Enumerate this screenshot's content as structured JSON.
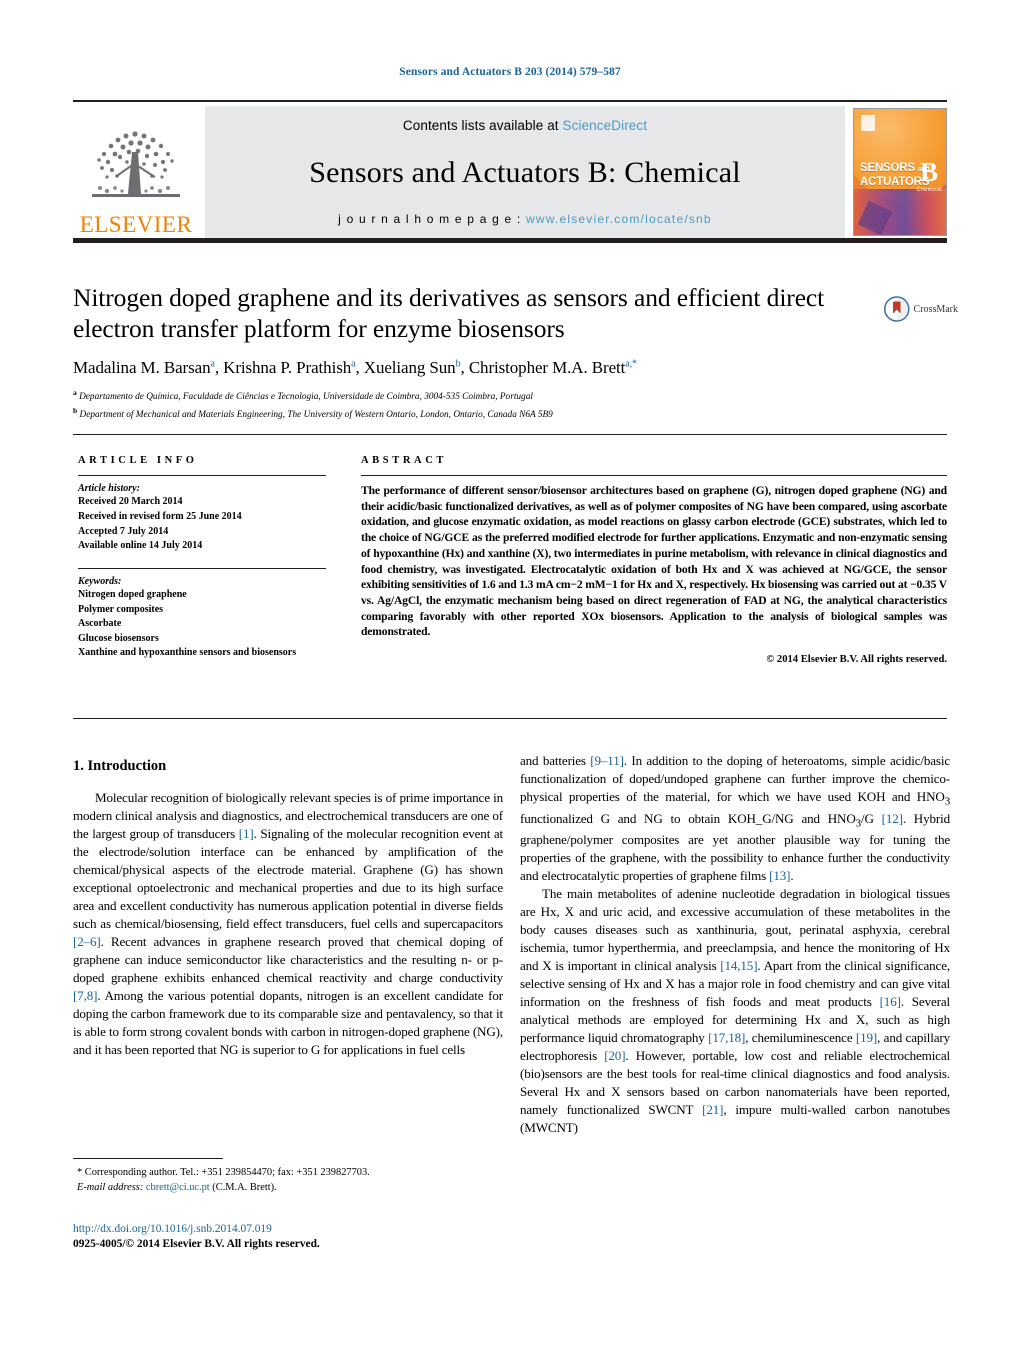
{
  "running_head": "Sensors and Actuators B 203 (2014) 579–587",
  "masthead": {
    "contents_prefix": "Contents lists available at ",
    "sciencedirect": "ScienceDirect",
    "journal_title": "Sensors and Actuators B: Chemical",
    "homepage_prefix": "j o u r n a l   h o m e p a g e :  ",
    "homepage_url": "www.elsevier.com/locate/snb",
    "publisher_wordmark": "ELSEVIER",
    "cover": {
      "line1": "SENSORS",
      "and": "and",
      "line2": "ACTUATORS",
      "letter": "B",
      "sub": "Chemical"
    }
  },
  "crossmark": {
    "label": "CrossMark"
  },
  "article": {
    "title": "Nitrogen doped graphene and its derivatives as sensors and efficient direct electron transfer platform for enzyme biosensors",
    "authors": [
      {
        "name": "Madalina M. Barsan",
        "sup": "a"
      },
      {
        "name": "Krishna P. Prathish",
        "sup": "a"
      },
      {
        "name": "Xueliang Sun",
        "sup": "b"
      },
      {
        "name": "Christopher M.A. Brett",
        "sup": "a,*"
      }
    ],
    "affiliations": [
      {
        "marker": "a",
        "text": "Departamento de Química, Faculdade de Ciências e Tecnologia, Universidade de Coimbra, 3004-535 Coimbra, Portugal"
      },
      {
        "marker": "b",
        "text": "Department of Mechanical and Materials Engineering, The University of Western Ontario, London, Ontario, Canada N6A 5B9"
      }
    ]
  },
  "article_info": {
    "heading": "ARTICLE INFO",
    "history_label": "Article history:",
    "history": [
      "Received 20 March 2014",
      "Received in revised form 25 June 2014",
      "Accepted 7 July 2014",
      "Available online 14 July 2014"
    ],
    "keywords_label": "Keywords:",
    "keywords": [
      "Nitrogen doped graphene",
      "Polymer composites",
      "Ascorbate",
      "Glucose biosensors",
      "Xanthine and hypoxanthine sensors and biosensors"
    ]
  },
  "abstract": {
    "heading": "ABSTRACT",
    "text": "The performance of different sensor/biosensor architectures based on graphene (G), nitrogen doped graphene (NG) and their acidic/basic functionalized derivatives, as well as of polymer composites of NG have been compared, using ascorbate oxidation, and glucose enzymatic oxidation, as model reactions on glassy carbon electrode (GCE) substrates, which led to the choice of NG/GCE as the preferred modified electrode for further applications. Enzymatic and non-enzymatic sensing of hypoxanthine (Hx) and xanthine (X), two intermediates in purine metabolism, with relevance in clinical diagnostics and food chemistry, was investigated. Electrocatalytic oxidation of both Hx and X was achieved at NG/GCE, the sensor exhibiting sensitivities of 1.6 and 1.3 mA cm−2 mM−1 for Hx and X, respectively. Hx biosensing was carried out at −0.35 V vs. Ag/AgCl, the enzymatic mechanism being based on direct regeneration of FAD at NG, the analytical characteristics comparing favorably with other reported XOx biosensors. Application to the analysis of biological samples was demonstrated.",
    "copyright": "© 2014 Elsevier B.V. All rights reserved."
  },
  "body": {
    "section_number_title": "1.  Introduction",
    "left_paragraphs": [
      "Molecular recognition of biologically relevant species is of prime importance in modern clinical analysis and diagnostics, and electrochemical transducers are one of the largest group of transducers [1]. Signaling of the molecular recognition event at the electrode/solution interface can be enhanced by amplification of the chemical/physical aspects of the electrode material. Graphene (G) has shown exceptional optoelectronic and mechanical properties and due to its high surface area and excellent conductivity has numerous application potential in diverse fields such as chemical/biosensing, field effect transducers, fuel cells and supercapacitors [2–6]. Recent advances in graphene research proved that chemical doping of graphene can induce semiconductor like characteristics and the resulting n- or p-doped graphene exhibits enhanced chemical reactivity and charge conductivity [7,8]. Among the various potential dopants, nitrogen is an excellent candidate for doping the carbon framework due to its comparable size and pentavalency, so that it is able to form strong covalent bonds with carbon in nitrogen-doped graphene (NG), and it has been reported that NG is superior to G for applications in fuel cells"
    ],
    "right_paragraphs": [
      "and batteries [9–11]. In addition to the doping of heteroatoms, simple acidic/basic functionalization of doped/undoped graphene can further improve the chemico-physical properties of the material, for which we have used KOH and HNO3 functionalized G and NG to obtain KOH_G/NG and HNO3/G [12]. Hybrid graphene/polymer composites are yet another plausible way for tuning the properties of the graphene, with the possibility to enhance further the conductivity and electrocatalytic properties of graphene films [13].",
      "The main metabolites of adenine nucleotide degradation in biological tissues are Hx, X and uric acid, and excessive accumulation of these metabolites in the body causes diseases such as xanthinuria, gout, perinatal asphyxia, cerebral ischemia, tumor hyperthermia, and preeclampsia, and hence the monitoring of Hx and X is important in clinical analysis [14,15]. Apart from the clinical significance, selective sensing of Hx and X has a major role in food chemistry and can give vital information on the freshness of fish foods and meat products [16]. Several analytical methods are employed for determining Hx and X, such as high performance liquid chromatography [17,18], chemiluminescence [19], and capillary electrophoresis [20]. However, portable, low cost and reliable electrochemical (bio)sensors are the best tools for real-time clinical diagnostics and food analysis. Several Hx and X sensors based on carbon nanomaterials have been reported, namely functionalized SWCNT [21], impure multi-walled carbon nanotubes (MWCNT)"
    ]
  },
  "footnote": {
    "corresponding": "* Corresponding author. Tel.: +351 239854470; fax: +351 239827703.",
    "email_label": "E-mail address:",
    "email": "cbrett@ci.uc.pt",
    "email_suffix": " (C.M.A. Brett).",
    "doi": "http://dx.doi.org/10.1016/j.snb.2014.07.019",
    "issn": "0925-4005/© 2014 Elsevier B.V. All rights reserved."
  },
  "colors": {
    "link": "#1a6496",
    "sciencedirect": "#4a9cc7",
    "elsevier_orange": "#ef8200",
    "masthead_bg": "#e6e7e8"
  }
}
